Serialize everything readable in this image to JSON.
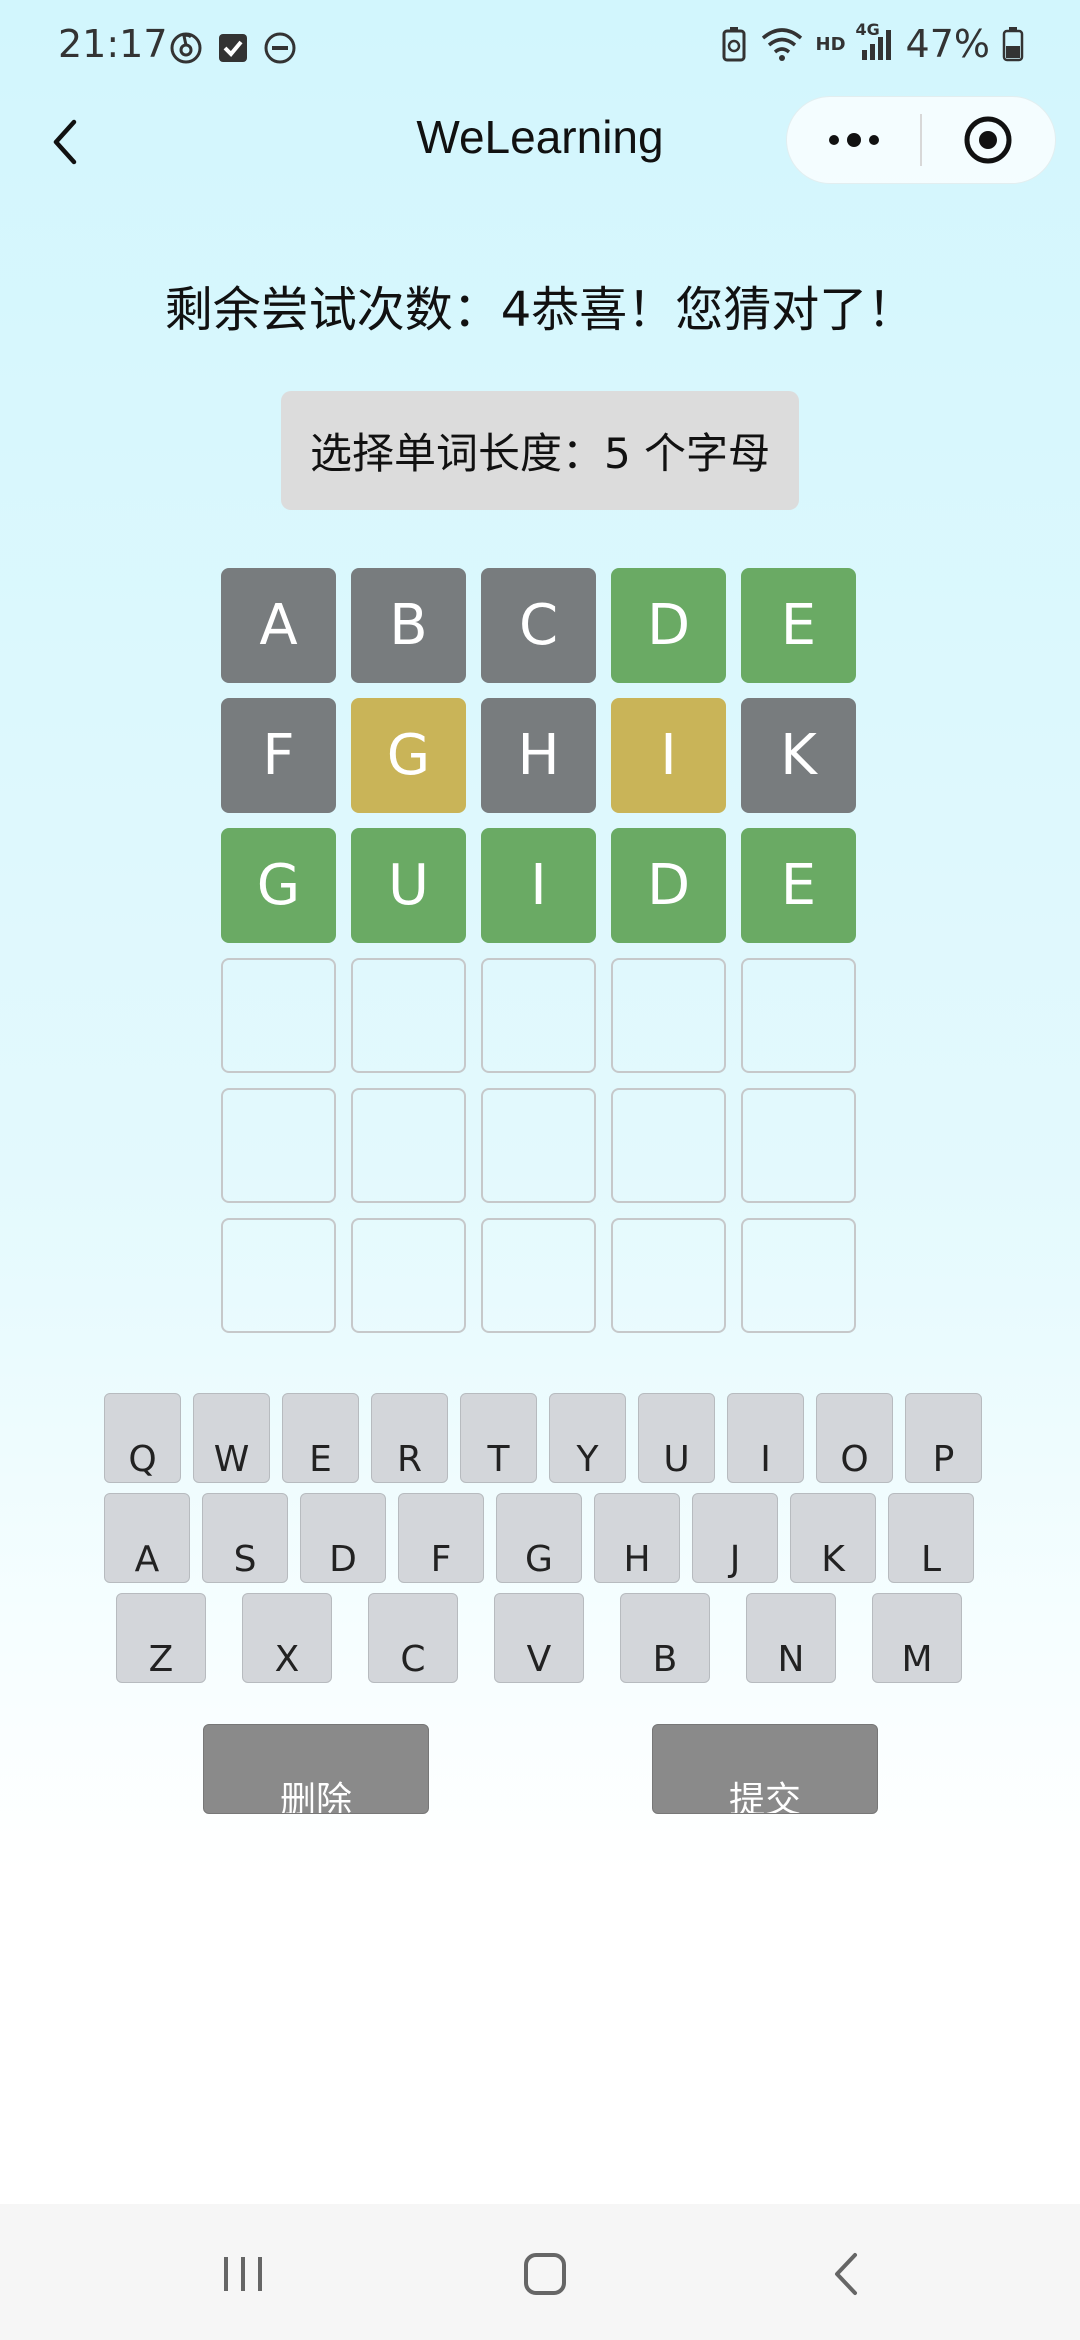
{
  "status_bar": {
    "time": "21:17",
    "battery": "47%",
    "network": "4G",
    "hd": "HD",
    "icons": [
      "netease-music-icon",
      "check-box-icon",
      "dnd-icon",
      "battery-saver-icon",
      "wifi-icon",
      "signal-icon",
      "battery-icon"
    ]
  },
  "nav": {
    "title": "WeLearning"
  },
  "game": {
    "status_text": "剩余尝试次数：4恭喜！您猜对了！",
    "length_button": "选择单词长度：5 个字母",
    "rows": [
      [
        {
          "letter": "A",
          "state": "gray"
        },
        {
          "letter": "B",
          "state": "gray"
        },
        {
          "letter": "C",
          "state": "gray"
        },
        {
          "letter": "D",
          "state": "green"
        },
        {
          "letter": "E",
          "state": "green"
        }
      ],
      [
        {
          "letter": "F",
          "state": "gray"
        },
        {
          "letter": "G",
          "state": "yellow"
        },
        {
          "letter": "H",
          "state": "gray"
        },
        {
          "letter": "I",
          "state": "yellow"
        },
        {
          "letter": "K",
          "state": "gray"
        }
      ],
      [
        {
          "letter": "G",
          "state": "green"
        },
        {
          "letter": "U",
          "state": "green"
        },
        {
          "letter": "I",
          "state": "green"
        },
        {
          "letter": "D",
          "state": "green"
        },
        {
          "letter": "E",
          "state": "green"
        }
      ],
      [
        {
          "letter": "",
          "state": "empty"
        },
        {
          "letter": "",
          "state": "empty"
        },
        {
          "letter": "",
          "state": "empty"
        },
        {
          "letter": "",
          "state": "empty"
        },
        {
          "letter": "",
          "state": "empty"
        }
      ],
      [
        {
          "letter": "",
          "state": "empty"
        },
        {
          "letter": "",
          "state": "empty"
        },
        {
          "letter": "",
          "state": "empty"
        },
        {
          "letter": "",
          "state": "empty"
        },
        {
          "letter": "",
          "state": "empty"
        }
      ],
      [
        {
          "letter": "",
          "state": "empty"
        },
        {
          "letter": "",
          "state": "empty"
        },
        {
          "letter": "",
          "state": "empty"
        },
        {
          "letter": "",
          "state": "empty"
        },
        {
          "letter": "",
          "state": "empty"
        }
      ]
    ],
    "colors": {
      "gray": "#787c7e",
      "green": "#6aaa64",
      "yellow": "#c9b458",
      "key": "#d3d6da",
      "action": "#8a8a8a"
    }
  },
  "keyboard": {
    "row1": [
      "Q",
      "W",
      "E",
      "R",
      "T",
      "Y",
      "U",
      "I",
      "O",
      "P"
    ],
    "row2": [
      "A",
      "S",
      "D",
      "F",
      "G",
      "H",
      "J",
      "K",
      "L"
    ],
    "row3": [
      "Z",
      "X",
      "C",
      "V",
      "B",
      "N",
      "M"
    ],
    "delete_label": "删除",
    "submit_label": "提交"
  }
}
